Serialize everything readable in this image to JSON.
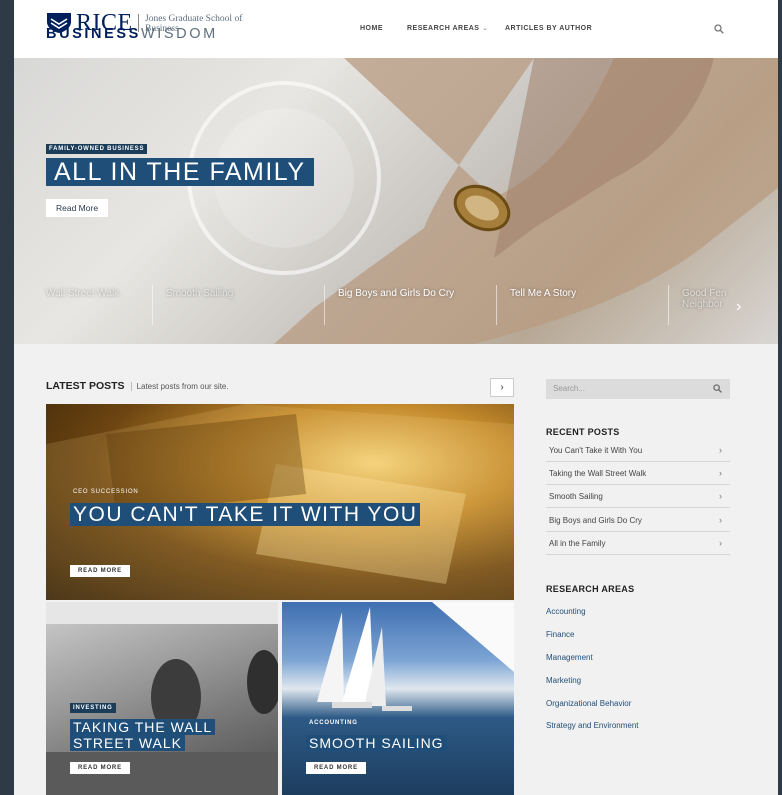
{
  "header": {
    "logo_rice": "RICE",
    "logo_school": "Jones Graduate School of Business",
    "brand_bold": "BUSINESS",
    "brand_light": "WISDOM",
    "nav": [
      "HOME",
      "RESEARCH AREAS",
      "ARTICLES BY AUTHOR"
    ]
  },
  "hero": {
    "tag": "FAMILY-OWNED BUSINESS",
    "title": "ALL IN THE FAMILY",
    "read_more": "Read More",
    "slider": [
      "Wall Street Walk",
      "Smooth Sailing",
      "Big Boys and Girls Do Cry",
      "Tell Me A Story",
      "Good Fen Neighbor"
    ]
  },
  "latest": {
    "heading": "LATEST POSTS",
    "subheading": "Latest posts from our site.",
    "next": "›"
  },
  "posts": [
    {
      "tag": "CEO SUCCESSION",
      "title": "YOU CAN'T TAKE IT WITH YOU",
      "read": "READ MORE"
    },
    {
      "tag": "INVESTING",
      "title": "TAKING THE WALL STREET WALK",
      "read": "READ MORE"
    },
    {
      "tag": "ACCOUNTING",
      "title": "SMOOTH SAILING",
      "read": "READ MORE"
    }
  ],
  "sidebar": {
    "search_placeholder": "Search...",
    "recent_heading": "RECENT POSTS",
    "recent": [
      "You Can't Take it With You",
      "Taking the Wall Street Walk",
      "Smooth Sailing",
      "Big Boys and Girls Do Cry",
      "All in the Family"
    ],
    "areas_heading": "RESEARCH AREAS",
    "areas": [
      "Accounting",
      "Finance",
      "Management",
      "Marketing",
      "Organizational Behavior",
      "Strategy and Environment"
    ]
  },
  "colors": {
    "navy": "#00205b",
    "title_bg": "#1f4e79",
    "link": "#1f4e79"
  },
  "icons": [
    "shield-logo-icon",
    "search-icon",
    "chevron-right-icon",
    "caret-down-icon"
  ]
}
